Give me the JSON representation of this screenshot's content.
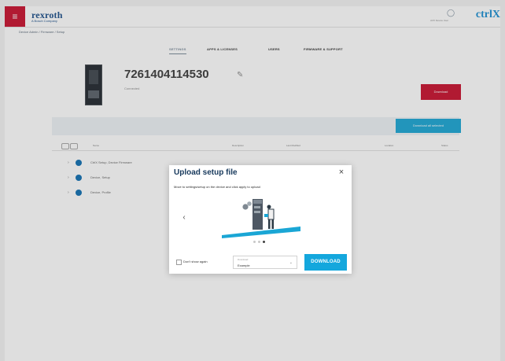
{
  "header": {
    "menu_icon": "menu-icon",
    "logo_text": "rexroth",
    "logo_subtext": "A Bosch Company",
    "user_icon": "user-icon",
    "user_text": "ctrlX Device User",
    "brand_prefix": "ctrl",
    "brand_suffix": "X"
  },
  "breadcrumb": "Device Admin / Firmware / Setup",
  "tabs": [
    {
      "label": "SETTINGS"
    },
    {
      "label": "APPS & LICENSES"
    },
    {
      "label": "USERS"
    },
    {
      "label": "FIRMWARE & SUPPORT"
    }
  ],
  "device": {
    "title": "7261404114530",
    "edit_icon": "edit-icon",
    "subtitle": "Connected",
    "action_label": "Download"
  },
  "table": {
    "toolbar_button": "Download all selected",
    "headers": [
      "Name",
      "Description",
      "Last Modified",
      "Location",
      "Status"
    ],
    "rows": [
      {
        "label": "CtrlX Setup, Device Firmware"
      },
      {
        "label": "Device, Setup"
      },
      {
        "label": "Device, Profile"
      }
    ]
  },
  "modal": {
    "title": "Upload setup file",
    "close_icon": "close-icon",
    "description": "Move to settings/setup on the device and click apply to upload",
    "left_arrow": "chevron-left-icon",
    "checkbox_label": "Don't show again",
    "select_label": "Download",
    "select_value": "Example",
    "download_button": "DOWNLOAD",
    "carousel_count": 3,
    "carousel_active": 3
  }
}
